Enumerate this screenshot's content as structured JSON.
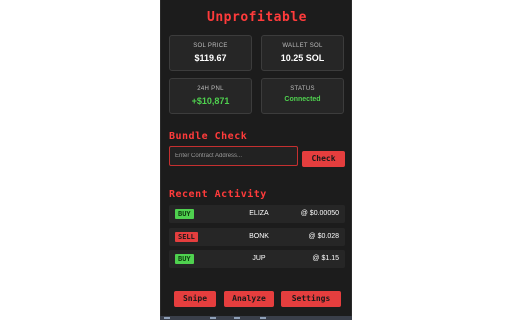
{
  "app": {
    "title": "Unprofitable"
  },
  "stats": [
    {
      "label": "SOL PRICE",
      "value": "$119.67"
    },
    {
      "label": "WALLET SOL",
      "value": "10.25 SOL"
    },
    {
      "label": "24H PNL",
      "value": "+$10,871"
    },
    {
      "label": "STATUS",
      "value": "Connected"
    }
  ],
  "bundle": {
    "title": "Bundle Check",
    "input_placeholder": "Enter Contract Address...",
    "input_value": "",
    "check_label": "Check"
  },
  "activity": {
    "title": "Recent Activity",
    "rows": [
      {
        "side": "BUY",
        "token": "ELIZA",
        "price": "@ $0.00050"
      },
      {
        "side": "SELL",
        "token": "BONK",
        "price": "@ $0.028"
      },
      {
        "side": "BUY",
        "token": "JUP",
        "price": "@ $1.15"
      }
    ]
  },
  "footer": {
    "snipe_label": "Snipe",
    "analyze_label": "Analyze",
    "settings_label": "Settings"
  },
  "colors": {
    "background": "#1c1c1c",
    "accent": "#e53e3e",
    "positive": "#4fd14f",
    "card": "#262626"
  }
}
